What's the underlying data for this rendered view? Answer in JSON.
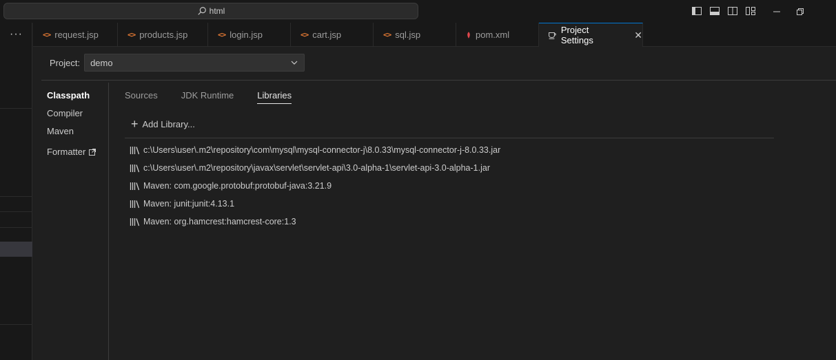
{
  "titlebar": {
    "search_text": "html"
  },
  "activity": {
    "more_label": "···"
  },
  "tabs": [
    {
      "label": "request.jsp",
      "icon": "code-icon"
    },
    {
      "label": "products.jsp",
      "icon": "code-icon"
    },
    {
      "label": "login.jsp",
      "icon": "code-icon"
    },
    {
      "label": "cart.jsp",
      "icon": "code-icon"
    },
    {
      "label": "sql.jsp",
      "icon": "code-icon"
    },
    {
      "label": "pom.xml",
      "icon": "maven-icon"
    },
    {
      "label": "Project Settings",
      "icon": "settings-cup-icon",
      "active": true
    }
  ],
  "project": {
    "label": "Project:",
    "value": "demo"
  },
  "nav": {
    "items": [
      "Classpath",
      "Compiler",
      "Maven",
      "Formatter"
    ],
    "active": "Classpath"
  },
  "subtabs": {
    "items": [
      "Sources",
      "JDK Runtime",
      "Libraries"
    ],
    "active": "Libraries"
  },
  "add_library": "Add Library...",
  "libraries": [
    "c:\\Users\\user\\.m2\\repository\\com\\mysql\\mysql-connector-j\\8.0.33\\mysql-connector-j-8.0.33.jar",
    "c:\\Users\\user\\.m2\\repository\\javax\\servlet\\servlet-api\\3.0-alpha-1\\servlet-api-3.0-alpha-1.jar",
    "Maven: com.google.protobuf:protobuf-java:3.21.9",
    "Maven: junit:junit:4.13.1",
    "Maven: org.hamcrest:hamcrest-core:1.3"
  ],
  "colors": {
    "accent": "#0078d4",
    "code_icon": "#e37933",
    "maven_icon": "#e0474c",
    "background": "#1f1f1f"
  }
}
